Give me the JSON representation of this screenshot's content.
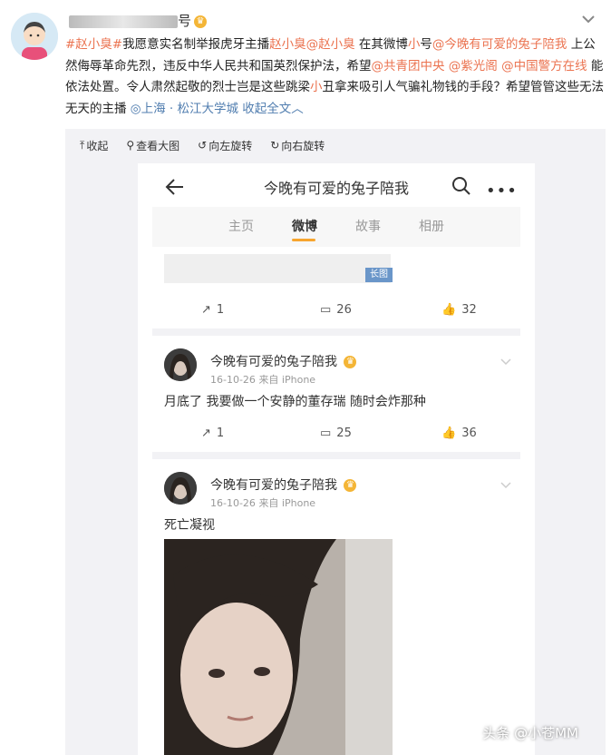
{
  "post": {
    "author_suffix": "号",
    "body_parts": [
      {
        "text": "#赵小臭#",
        "style": "link"
      },
      {
        "text": "我愿意实名制举报虎牙主播",
        "style": "normal"
      },
      {
        "text": "赵小臭",
        "style": "link"
      },
      {
        "text": "@赵小臭",
        "style": "link"
      },
      {
        "text": " 在其微博",
        "style": "normal"
      },
      {
        "text": "小",
        "style": "link"
      },
      {
        "text": "号",
        "style": "normal"
      },
      {
        "text": "@今晚有可爱的兔子陪我",
        "style": "link"
      },
      {
        "text": " 上公然侮辱革命先烈，违反中华人民共和国英烈保护法，希望",
        "style": "normal"
      },
      {
        "text": "@共青团中央",
        "style": "link"
      },
      {
        "text": " ",
        "style": "normal"
      },
      {
        "text": "@紫光阁",
        "style": "link"
      },
      {
        "text": " ",
        "style": "normal"
      },
      {
        "text": "@中国警方在线",
        "style": "link"
      },
      {
        "text": " 能依法处置。令人肃然起敬的烈士岂是这些跳梁",
        "style": "normal"
      },
      {
        "text": "小",
        "style": "link"
      },
      {
        "text": "丑拿来吸引人气骗礼物钱的手段？希望管管这些无法无天的主播 ",
        "style": "normal"
      },
      {
        "text": "◎上海 · 松江大学城",
        "style": "blue"
      },
      {
        "text": " 收起全文︿",
        "style": "blue"
      }
    ]
  },
  "toolbar": {
    "collapse": "收起",
    "view_large": "查看大图",
    "rotate_left": "向左旋转",
    "rotate_right": "向右旋转"
  },
  "profile": {
    "title": "今晚有可爱的兔子陪我",
    "tabs": [
      "主页",
      "微博",
      "故事",
      "相册"
    ],
    "active_tab": "微博"
  },
  "posts": [
    {
      "long_image_tag": "长图",
      "reposts": "1",
      "comments": "26",
      "likes": "32"
    },
    {
      "name": "今晚有可爱的兔子陪我",
      "date": "16-10-26",
      "source": "来自 iPhone",
      "text": "月底了 我要做一个安静的董存瑞 随时会炸那种",
      "reposts": "1",
      "comments": "25",
      "likes": "36"
    },
    {
      "name": "今晚有可爱的兔子陪我",
      "date": "16-10-26",
      "source": "来自 iPhone",
      "text": "死亡凝视"
    }
  ],
  "watermark": "头条 @小苍MM",
  "colors": {
    "link": "#eb7350",
    "blue": "#507daf",
    "tab_indicator": "#f7a52e",
    "long_tag": "#6a96c9"
  }
}
